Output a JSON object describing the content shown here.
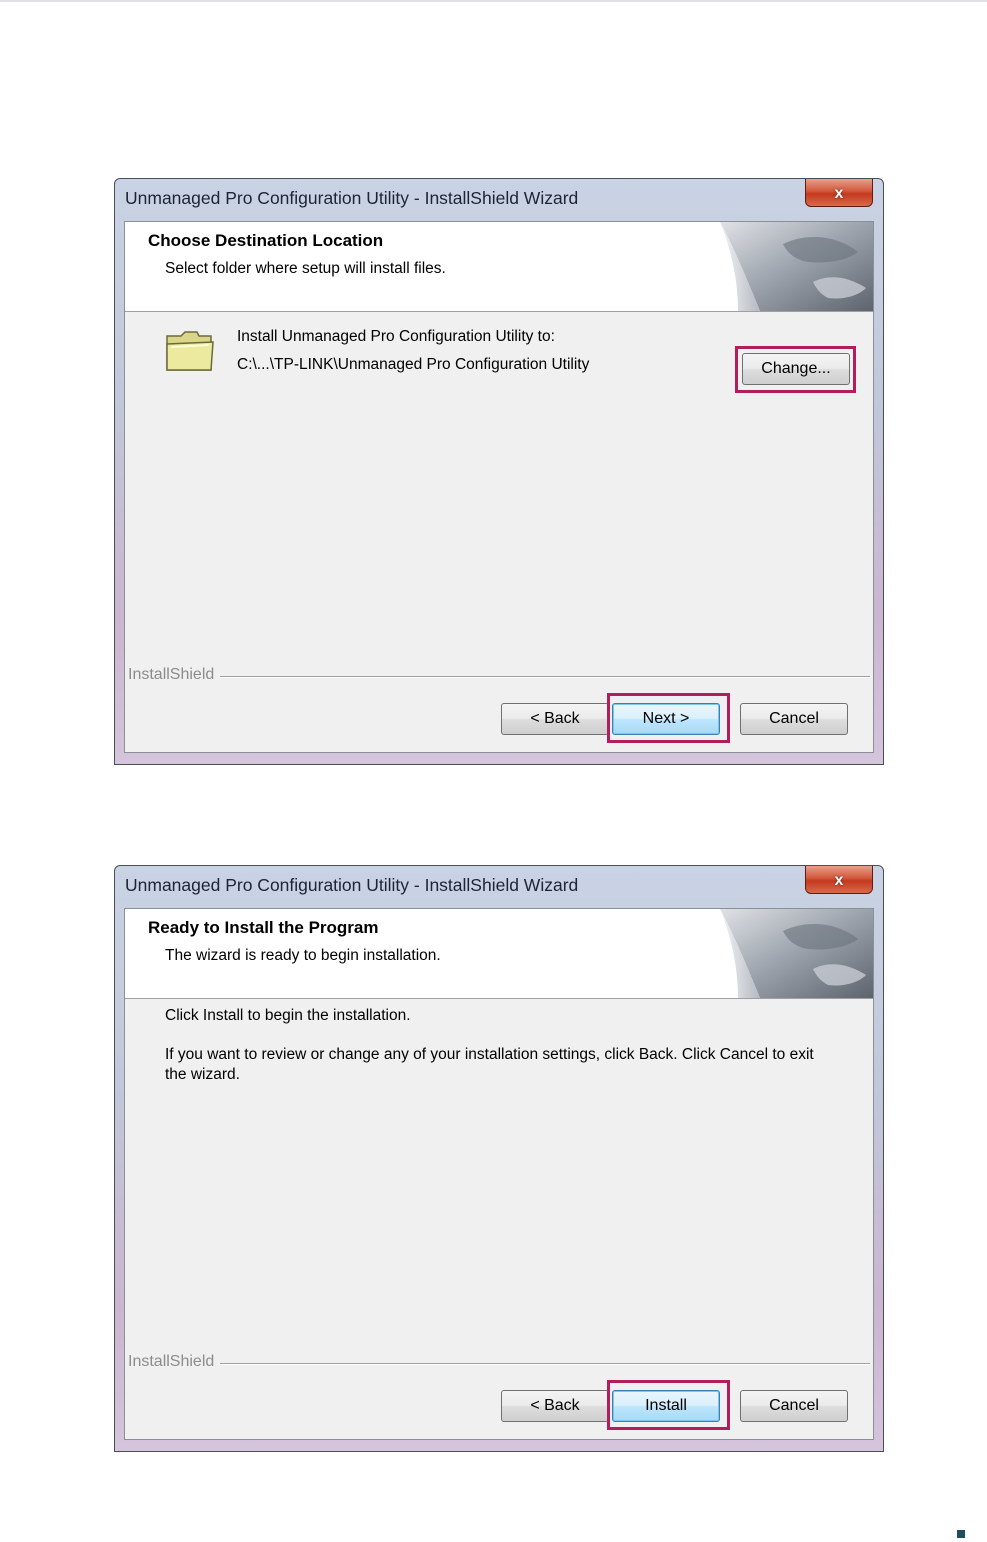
{
  "colors": {
    "highlight": "#b01f5c",
    "close_button": "#c33a1f",
    "page_mark": "#1c4e5c"
  },
  "icons": {
    "close": "close-icon",
    "folder": "folder-icon",
    "header_art": "installshield-page-curl-art"
  },
  "dialogs": [
    {
      "title": "Unmanaged Pro Configuration Utility - InstallShield Wizard",
      "close_glyph": "x",
      "header_title": "Choose Destination Location",
      "header_subtitle": "Select folder where setup will install files.",
      "install_to_label": "Install Unmanaged Pro Configuration Utility to:",
      "install_path": "C:\\...\\TP-LINK\\Unmanaged Pro Configuration Utility",
      "change_label": "Change...",
      "brand": "InstallShield",
      "back_label": "< Back",
      "next_label": "Next >",
      "cancel_label": "Cancel",
      "highlighted": [
        "Change...",
        "Next >"
      ]
    },
    {
      "title": "Unmanaged Pro Configuration Utility - InstallShield Wizard",
      "close_glyph": "x",
      "header_title": "Ready to Install the Program",
      "header_subtitle": "The wizard is ready to begin installation.",
      "body_line1": "Click Install to begin the installation.",
      "body_line2a": "If you want to review or change any of your installation settings, click Back. Click Cancel to exit",
      "body_line2b": "the wizard.",
      "brand": "InstallShield",
      "back_label": "< Back",
      "install_label": "Install",
      "cancel_label": "Cancel",
      "highlighted": [
        "Install"
      ]
    }
  ]
}
